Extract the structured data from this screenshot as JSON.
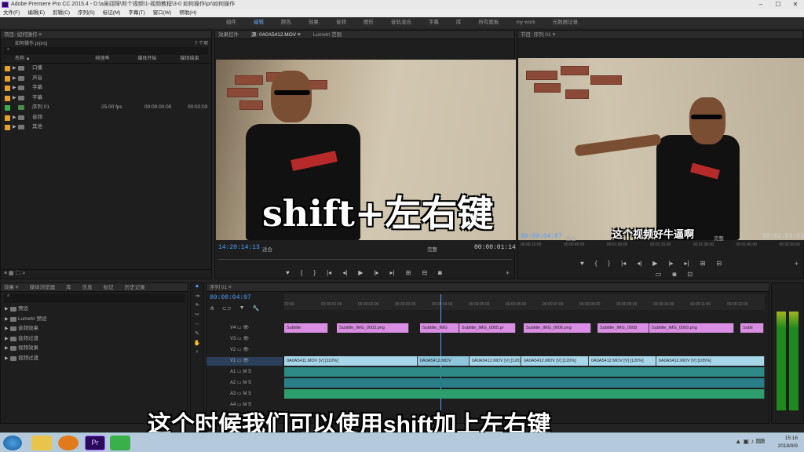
{
  "title": "Adobe Premiere Pro CC 2015.4 - D:\\a吴翊琛\\剪个视频\\1-视频教程\\3-0 如何操作\\pr\\如何操作",
  "menu": [
    "文件(F)",
    "编辑(E)",
    "剪辑(C)",
    "序列(S)",
    "标记(M)",
    "字幕(T)",
    "窗口(W)",
    "帮助(H)"
  ],
  "workspaces": [
    "组件",
    "编辑",
    "颜色",
    "效果",
    "音频",
    "图形",
    "音轨混合",
    "字幕",
    "库",
    "所有面板",
    "my work",
    "元数据记录"
  ],
  "project": {
    "tab": "项目: 如何操作 ≡",
    "file": "如何操作.prproj",
    "count": "7 个项",
    "columns": [
      "名称 ▲",
      "帧速率",
      "媒体开始",
      "媒体结束"
    ],
    "items": [
      {
        "name": "口播",
        "color": "#e8a02a"
      },
      {
        "name": "声音",
        "color": "#e8a02a"
      },
      {
        "name": "字幕",
        "color": "#e8a02a"
      },
      {
        "name": "字幕",
        "color": "#e8a02a"
      },
      {
        "name": "序列 01",
        "color": "#3ab04a",
        "fps": "25.00 fps",
        "start": "00:00:00:00",
        "end": "00:02:03"
      },
      {
        "name": "音频",
        "color": "#e8a02a"
      },
      {
        "name": "其他",
        "color": "#e8a02a"
      }
    ]
  },
  "source": {
    "tabs": [
      "效果控件",
      "源: 0A0A5412.MOV ≡",
      "Lumetri 范围"
    ],
    "tc": "14:20:14:13",
    "fit": "适合",
    "quality": "完整",
    "dur": "00:00:01:14"
  },
  "program": {
    "tab": "节目: 序列 01 ≡",
    "tc": "00:00:04:07",
    "fit": "适合",
    "quality": "完整",
    "dur": "00:02:03:03",
    "subtitle": "这个视频好牛逼啊",
    "ruler": [
      "00:00:15:00",
      "00:00:45:00",
      "00:01:00:00",
      "00:01:15:00",
      "00:01:30:00",
      "00:01:45:00",
      "00:02:00:00"
    ]
  },
  "effects": {
    "tabs": [
      "效果 ≡",
      "媒体浏览器",
      "库",
      "信息",
      "标记",
      "历史记录"
    ],
    "items": [
      "预设",
      "Lumetri 预设",
      "音频效果",
      "音频过渡",
      "视频效果",
      "视频过渡"
    ]
  },
  "timeline": {
    "tab": "序列 01 ≡",
    "tc": "00:00:04:07",
    "ruler": [
      "00:00",
      "00:00:01:00",
      "00:00:02:00",
      "00:00:03:00",
      "00:00:04:00",
      "00:00:05:00",
      "00:00:06:00",
      "00:00:07:00",
      "00:00:08:00",
      "00:00:09:00",
      "00:00:10:00",
      "00:00:11:00",
      "00:00:12:00"
    ],
    "tracks": [
      "V4",
      "V3",
      "V2",
      "V1",
      "A1",
      "A2",
      "A3",
      "A4"
    ],
    "subtitles": [
      "Subtitle",
      "Subtitle_IMG_0003.png",
      "Subtitle_IMG",
      "Subtitle_IMG_0005.pr",
      "Subtitle_IMG_0006.png",
      "Subtitle_IMG_0008",
      "Subtitle_IMG_0009.png",
      "Subti"
    ],
    "video": [
      "0A0A5411.MOV [V] [110%]",
      "0A0A5412.MOV",
      "0A0A5412.MOV [V] [120]",
      "0A0A5412.MOV [V] [120%]",
      "0A0A5412.MOV [V] [120%]",
      "0A0A5412.MOV [V] [105%]"
    ]
  },
  "overlay": {
    "main": "shift+左右键",
    "bottom": "这个时候我们可以使用shift加上左右键"
  },
  "clock": {
    "time": "15:16",
    "date": "2018/9/9"
  }
}
